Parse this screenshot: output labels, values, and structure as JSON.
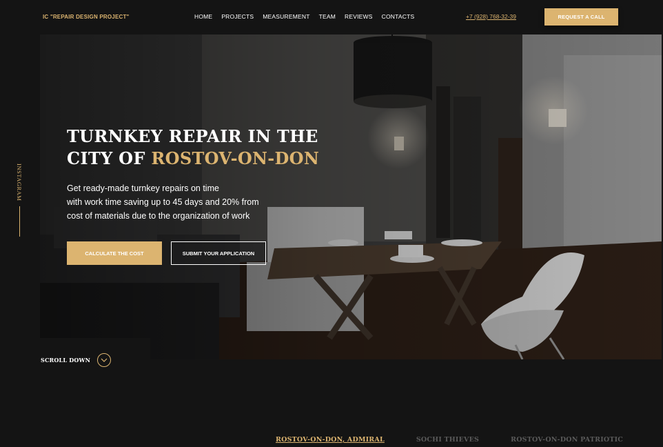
{
  "header": {
    "logo": "IC \"REPAIR DESIGN PROJECT\"",
    "nav": [
      "HOME",
      "PROJECTS",
      "MEASUREMENT",
      "TEAM",
      "REVIEWS",
      "CONTACTS"
    ],
    "phone": "+7 (928) 768-32-39",
    "call_button": "REQUEST A CALL"
  },
  "side": {
    "instagram": "INSTAGRAM"
  },
  "hero": {
    "title_line1": "TURNKEY REPAIR IN THE",
    "title_line2_prefix": "CITY OF ",
    "title_line2_accent": "ROSTOV-ON-DON",
    "subtitle_lines": [
      "Get ready-made turnkey repairs on time",
      "with work time saving up to 45 days and 20% from",
      "cost of materials due to the organization of work"
    ],
    "calc_button": "CALCULATE THE COST",
    "submit_button": "SUBMIT YOUR APPLICATION",
    "scroll_label": "SCROLL DOWN"
  },
  "projects": {
    "tabs": [
      "ROSTOV-ON-DON, ADMIRAL",
      "SOCHI THIEVES",
      "ROSTOV-ON-DON PATRIOTIC"
    ],
    "active_index": 0
  },
  "colors": {
    "accent": "#dcb470",
    "background": "#141414"
  }
}
